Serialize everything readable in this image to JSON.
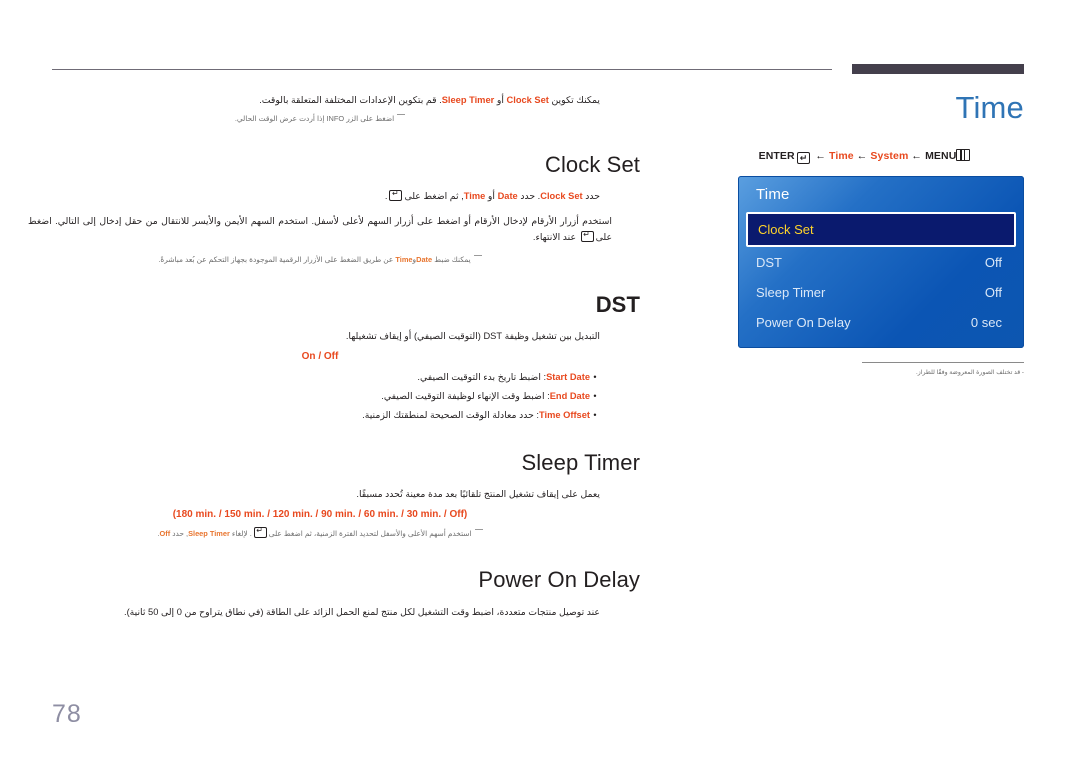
{
  "page": {
    "number": "78",
    "chapter_title": "Time"
  },
  "breadcrumb": {
    "enter": "ENTER",
    "enter_icon": "enter-key-icon",
    "arrow": "←",
    "time": "Time",
    "system": "System",
    "menu": "MENU",
    "menu_icon": "menu-grid-icon"
  },
  "osd": {
    "title": "Time",
    "rows": [
      {
        "label": "Clock Set",
        "value": "",
        "selected": true
      },
      {
        "label": "DST",
        "value": "Off",
        "selected": false
      },
      {
        "label": "Sleep Timer",
        "value": "Off",
        "selected": false
      },
      {
        "label": "Power On Delay",
        "value": "0 sec",
        "selected": false
      }
    ],
    "note": "‏- قد تختلف الصورة المعروضة وفقًا للطراز."
  },
  "intro": {
    "line1_a": "يمكنك تكوين",
    "line1_clock": "Clock Set",
    "line1_or": "أو",
    "line1_sleep": "Sleep Timer",
    "line1_b": ". قم بتكوين الإعدادات المختلفة المتعلقة بالوقت.",
    "note": "اضغط على الزر INFO إذا أردت عرض الوقت الحالي.",
    "note_key": "INFO"
  },
  "sections": [
    {
      "id": "clock-set",
      "heading": "Clock Set",
      "line1_a": "حدد",
      "line1_clock": "Clock Set",
      "line1_b": ". حدد",
      "line1_date": "Date",
      "line1_or": "أو",
      "line1_time": "Time",
      "line1_c": ", ثم اضغط على",
      "line1_d": ".",
      "body": "استخدم أزرار الأرقام لإدخال الأرقام أو اضغط على أزرار السهم لأعلى لأسفل. استخدم السهم الأيمن والأيسر للانتقال من حقل إدخال إلى التالي. اضغط على",
      "body_tail": "عند الانتهاء.",
      "note_a": "يمكنك ضبط",
      "note_date": "Date",
      "note_and": "و",
      "note_time": "Time",
      "note_b": "عن طريق الضغط على الأزرار الرقمية الموجودة بجهاز التحكم عن بُعد مباشرةً."
    },
    {
      "id": "dst",
      "heading": "DST",
      "body": "التبديل بين تشغيل وظيفة DST (التوقيت الصيفي) أو إيقاف تشغيلها.",
      "options": "On / Off",
      "bullets": [
        {
          "term": "Start Date",
          "desc": ": اضبط تاريخ بدء التوقيت الصيفي."
        },
        {
          "term": "End Date",
          "desc": ": اضبط وقت الإنهاء لوظيفة التوقيت الصيفي."
        },
        {
          "term": "Time Offset",
          "desc": ": حدد معادلة الوقت الصحيحة لمنطقتك الزمنية."
        }
      ]
    },
    {
      "id": "sleep-timer",
      "heading": "Sleep Timer",
      "body": "يعمل على إيقاف تشغيل المنتج تلقائيًا بعد مدة معينة تُحدد مسبقًا.",
      "options": "(180 min. / 150 min. / 120 min. / 90 min. / 60 min. / 30 min. / Off)",
      "note_a": "استخدم أسهم الأعلى والأسفل لتحديد الفترة الزمنية، ثم اضغط على",
      "note_b": ". لإلغاء",
      "note_term": "Sleep Timer",
      "note_c": ", حدد",
      "note_off": "Off",
      "note_d": "."
    },
    {
      "id": "power-on-delay",
      "heading": "Power On Delay",
      "body": "عند توصيل منتجات متعددة، اضبط وقت التشغيل لكل منتج لمنع الحمل الزائد على الطاقة (في نطاق يتراوح من 0 إلى 50 ثانية)."
    }
  ],
  "colors": {
    "accent_orange": "#e8491f",
    "heading_blue": "#2f74b5",
    "osd_selected_text": "#ffd42a",
    "page_number": "#8e8ea3"
  }
}
